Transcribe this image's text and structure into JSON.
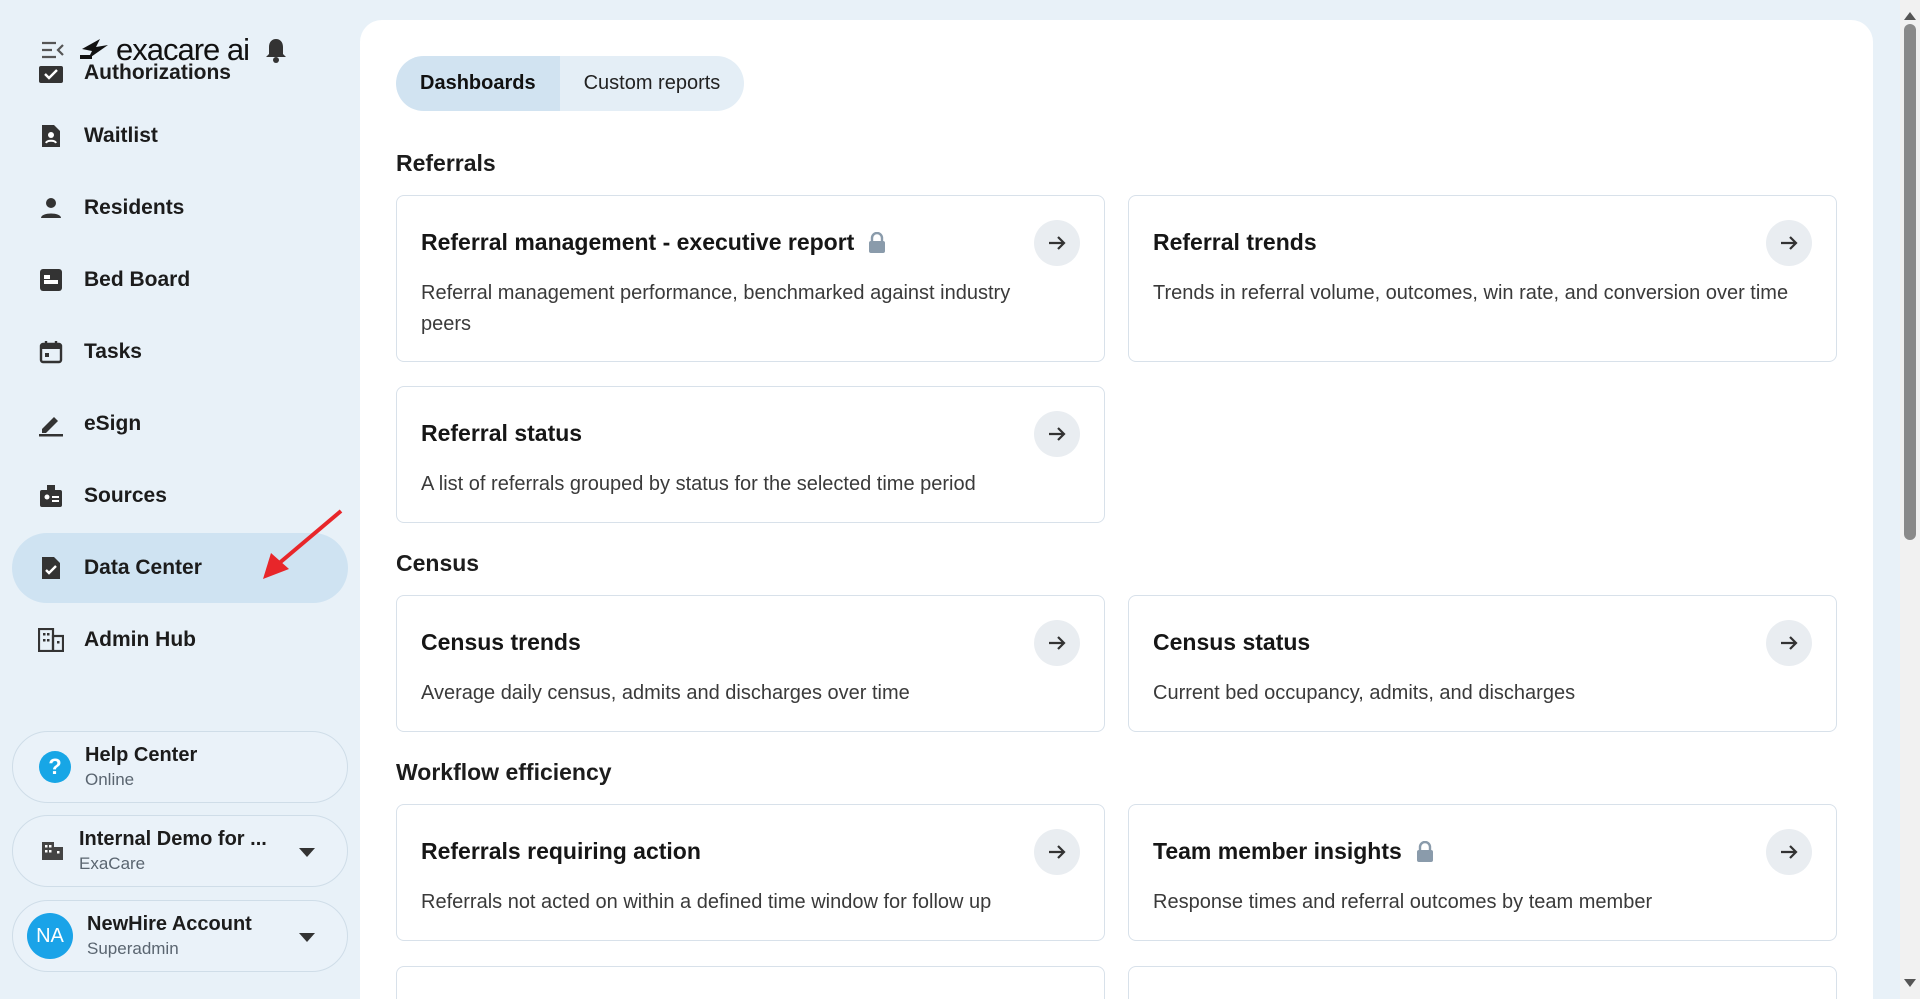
{
  "brand": {
    "name": "exacare ai"
  },
  "sidebar": {
    "items": [
      {
        "label": "Authorizations",
        "icon": "authorizations-icon"
      },
      {
        "label": "Waitlist",
        "icon": "waitlist-icon"
      },
      {
        "label": "Residents",
        "icon": "person-icon"
      },
      {
        "label": "Bed Board",
        "icon": "bed-board-icon"
      },
      {
        "label": "Tasks",
        "icon": "calendar-icon"
      },
      {
        "label": "eSign",
        "icon": "pen-icon"
      },
      {
        "label": "Sources",
        "icon": "badge-icon"
      },
      {
        "label": "Data Center",
        "icon": "data-center-icon",
        "active": true
      },
      {
        "label": "Admin Hub",
        "icon": "building-icon"
      }
    ],
    "help": {
      "title": "Help Center",
      "status": "Online"
    },
    "org": {
      "title": "Internal Demo for ...",
      "sub": "ExaCare"
    },
    "user": {
      "initials": "NA",
      "name": "NewHire Account",
      "role": "Superadmin"
    }
  },
  "tabs": [
    {
      "label": "Dashboards",
      "active": true
    },
    {
      "label": "Custom reports",
      "active": false
    }
  ],
  "sections": {
    "referrals": "Referrals",
    "census": "Census",
    "workflow": "Workflow efficiency"
  },
  "cards": {
    "ref_exec": {
      "title": "Referral management - executive report",
      "desc": "Referral management performance, benchmarked against industry peers",
      "locked": true
    },
    "ref_trends": {
      "title": "Referral trends",
      "desc": "Trends in referral volume, outcomes, win rate, and conversion over time",
      "locked": false
    },
    "ref_status": {
      "title": "Referral status",
      "desc": "A list of referrals grouped by status for the selected time period",
      "locked": false
    },
    "census_trends": {
      "title": "Census trends",
      "desc": "Average daily census, admits and discharges over time",
      "locked": false
    },
    "census_status": {
      "title": "Census status",
      "desc": "Current bed occupancy, admits, and discharges",
      "locked": false
    },
    "ref_action": {
      "title": "Referrals requiring action",
      "desc": "Referrals not acted on within a defined time window for follow up",
      "locked": false
    },
    "team_insights": {
      "title": "Team member insights",
      "desc": "Response times and referral outcomes by team member",
      "locked": true
    }
  },
  "colors": {
    "accent": "#cfe3f2",
    "annotation": "#e8262a",
    "avatar": "#1aa3e8"
  }
}
